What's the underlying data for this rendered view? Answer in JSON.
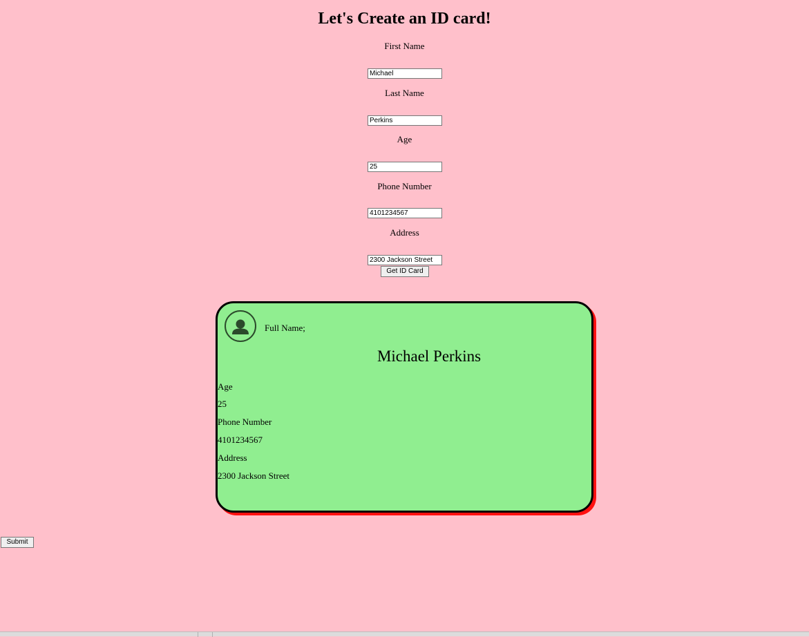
{
  "page": {
    "heading": "Let's Create an ID card!"
  },
  "form": {
    "first_name": {
      "label": "First Name",
      "value": "Michael"
    },
    "last_name": {
      "label": "Last Name",
      "value": "Perkins"
    },
    "age": {
      "label": "Age",
      "value": "25"
    },
    "phone": {
      "label": "Phone Number",
      "value": "4101234567"
    },
    "address": {
      "label": "Address",
      "value": "2300 Jackson Street"
    },
    "get_card_button": "Get ID Card"
  },
  "card": {
    "full_name_label": "Full Name;",
    "full_name": "Michael Perkins",
    "age_label": "Age",
    "age": "25",
    "phone_label": "Phone Number",
    "phone": "4101234567",
    "address_label": "Address",
    "address": "2300 Jackson Street",
    "avatar_icon": "user-icon"
  },
  "submit_button": "Submit",
  "colors": {
    "page_background": "#ffc0cb",
    "card_background": "#90ee90",
    "card_border": "#000000",
    "card_shadow": "#ff1010"
  }
}
